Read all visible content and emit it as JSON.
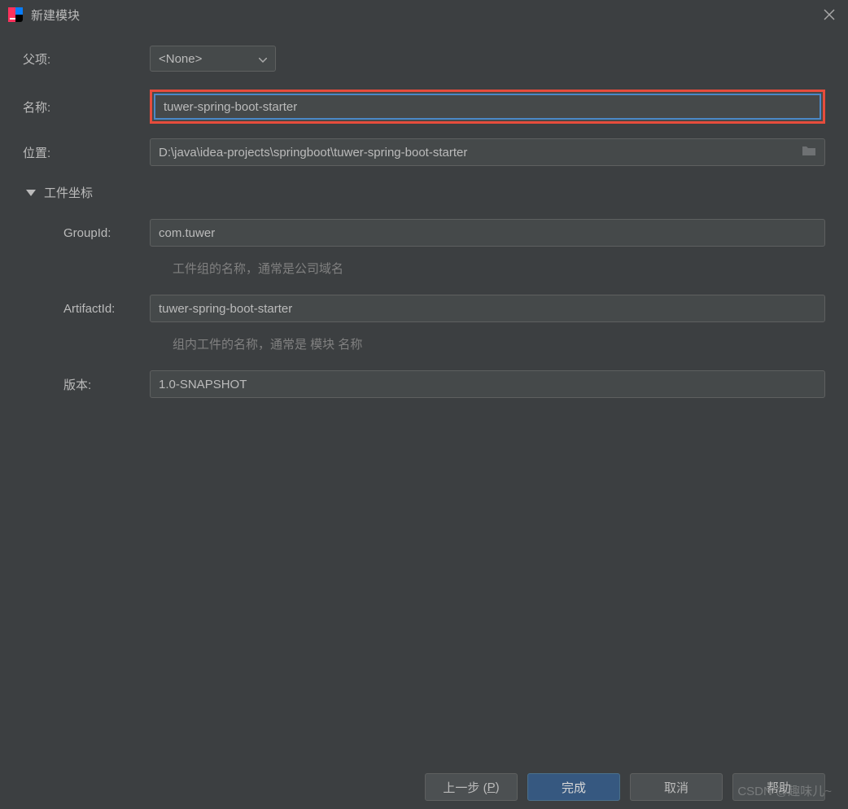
{
  "titlebar": {
    "title": "新建模块"
  },
  "form": {
    "parent_label": "父项:",
    "parent_value": "<None>",
    "name_label": "名称:",
    "name_value": "tuwer-spring-boot-starter",
    "location_label": "位置:",
    "location_value": "D:\\java\\idea-projects\\springboot\\tuwer-spring-boot-starter",
    "coordinates_header": "工件坐标",
    "groupid_label": "GroupId:",
    "groupid_value": "com.tuwer",
    "groupid_hint": "工件组的名称，通常是公司域名",
    "artifactid_label": "ArtifactId:",
    "artifactid_value": "tuwer-spring-boot-starter",
    "artifactid_hint": "组内工件的名称，通常是 模块 名称",
    "version_label": "版本:",
    "version_value": "1.0-SNAPSHOT"
  },
  "buttons": {
    "prev_prefix": "上一步 (",
    "prev_mnemonic": "P",
    "prev_suffix": ")",
    "finish": "完成",
    "cancel": "取消",
    "help": "帮助"
  },
  "watermark": "CSDN @趣味儿~"
}
